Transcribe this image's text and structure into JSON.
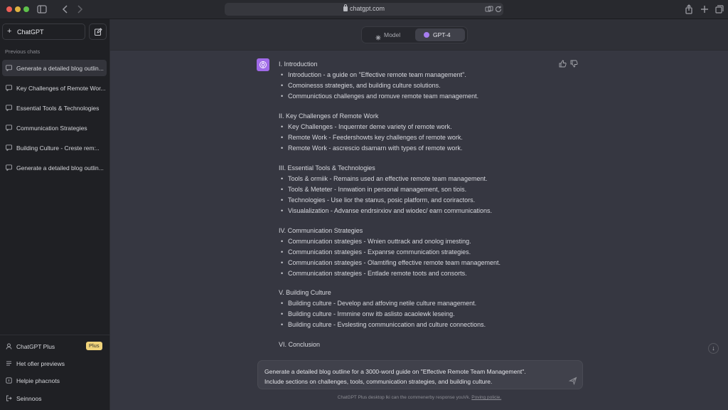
{
  "browser": {
    "url": "chatgpt.com"
  },
  "sidebar": {
    "new_chat_label": "ChatGPT",
    "section_label": "Previous chats",
    "chats": [
      {
        "label": "Generate a detailed blog outlin..."
      },
      {
        "label": "Key Challenges of Remote Wor..."
      },
      {
        "label": "Essential Tools & Technologies"
      },
      {
        "label": "Communication Strategies"
      },
      {
        "label": "Building Culture - Creste rem:.."
      },
      {
        "label": "Generate a detailed blog outlin..."
      }
    ],
    "footer": {
      "plus_label": "ChatGPT Plus",
      "plus_badge": "Plus",
      "item2": "Het ofier previews",
      "item3": "Helpie phacnots",
      "item4": "Seinnoos"
    }
  },
  "topbar": {
    "model_label": "Model",
    "gpt4_label": "GPT-4"
  },
  "response": {
    "sections": [
      {
        "title": "I. Introduction",
        "bullets": [
          "Introduction - a guide on \"Effective remote team management\".",
          "Comoinesss strategies, and building culture solutions.",
          "Communictious challenges and romuve remote team management."
        ]
      },
      {
        "title": "II. Key Challenges of Remote Work",
        "bullets": [
          "Key Challenges - Inquernter deme variety of remote work.",
          "Remote Work - Feedershowts key challenges of remote work.",
          "Remote Work - ascrescio dsamarn with types of remote work."
        ]
      },
      {
        "title": "III. Essential Tools & Technologies",
        "bullets": [
          "Tools & ormiik - Remains used an effective remote team management.",
          "Tools & Meteter - Innwation in personal management, son tiois.",
          "Technologies - Use lior the stanus, posic platform, and coriractors.",
          "Visualalization - Advanse endrsirxiov and wiodec/ earn communications."
        ]
      },
      {
        "title": "IV. Communication Strategies",
        "bullets": [
          "Communication strategies - Wnien outtrack and onolog imesting.",
          "Communication strategies - Expanrse communication strategies.",
          "Communication strategies - Olamtifing effective remote team management.",
          "Communication strategies - Entlade remote toots and consorts."
        ]
      },
      {
        "title": "V. Building Culture",
        "bullets": [
          "Building culture - Develop and atfoving netile culture management.",
          "Building culture - Irmmine onw itb aslisto acaolewk leseing.",
          "Building culture - Evslesting communiccation and culture connections."
        ]
      },
      {
        "title": "VI. Conclusion",
        "bullets": []
      }
    ]
  },
  "composer": {
    "line1": "Generate a detailed blog outline for a 3000-word guide on \"Effective Remote Team Management\".",
    "line2": "Include sections on challenges, tools, communication strategies, and building culture."
  },
  "footnote": {
    "text": "ChatGPT Plus desktop lki can the commenerby response youVk.",
    "link": "Poving policie."
  },
  "colors": {
    "sidebar_bg": "#1f2024",
    "main_bg": "#363741",
    "accent_purple": "#a06ae8",
    "plus_badge": "#f0d37a"
  },
  "icons": {
    "sidebar_toggle": "sidebar-icon",
    "back": "chevron-left-icon",
    "forward": "chevron-right-icon",
    "share": "share-icon",
    "new_tab": "plus-icon",
    "tabs": "tabs-icon",
    "edit": "edit-icon",
    "chat": "chat-bubble-icon",
    "thumbs_up": "thumbs-up-icon",
    "thumbs_down": "thumbs-down-icon",
    "send": "send-icon",
    "scroll_down": "arrow-down-icon"
  }
}
